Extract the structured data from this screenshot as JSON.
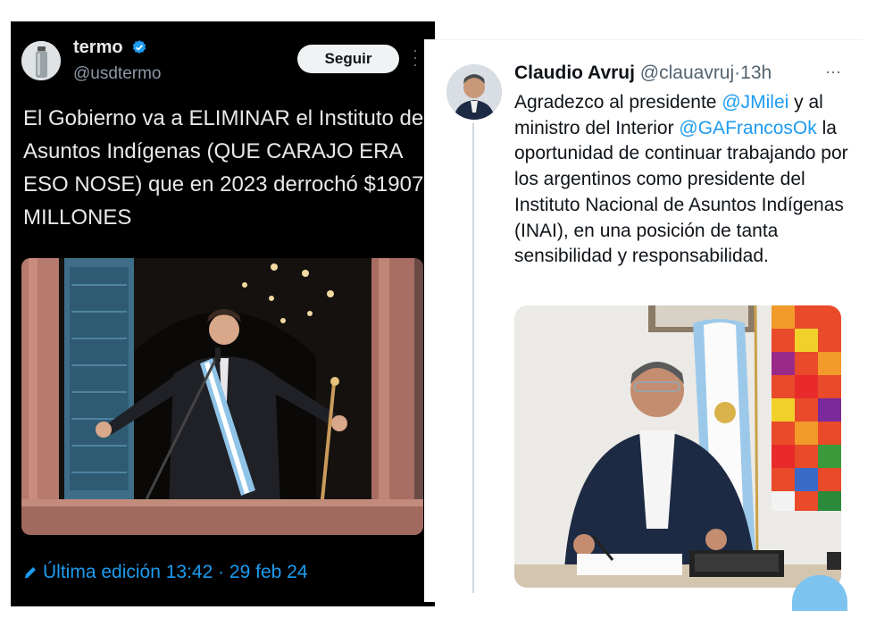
{
  "left_tweet": {
    "name": "termo",
    "handle": "@usdtermo",
    "follow_label": "Seguir",
    "text": "El Gobierno va a ELIMINAR el Instituto de Asuntos Indígenas (QUE CARAJO ERA ESO NOSE) que en 2023 derrochó $1907 MILLONES",
    "edited_label": "Última edición 13:42 · 29 feb 24",
    "icons": [
      "verified-badge-icon",
      "more-icon",
      "pencil-icon"
    ],
    "colors": {
      "background": "#000000",
      "accent": "#1d9bf0",
      "text": "#e7e9ea"
    }
  },
  "right_tweet": {
    "name": "Claudio Avruj",
    "handle": "@clauavruj",
    "separator": "·",
    "time": "13h",
    "text_parts": [
      {
        "type": "text",
        "value": "Agradezco al presidente "
      },
      {
        "type": "mention",
        "value": "@JMilei"
      },
      {
        "type": "text",
        "value": " y al ministro del Interior "
      },
      {
        "type": "mention",
        "value": "@GAFrancosOk"
      },
      {
        "type": "text",
        "value": " la oportunidad de continuar trabajando por los argentinos como presidente del Instituto Nacional de Asuntos Indígenas (INAI), en una posición de tanta sensibilidad y responsabilidad."
      }
    ],
    "icons": [
      "more-icon"
    ],
    "colors": {
      "background": "#ffffff",
      "mention": "#1d9bf0",
      "text": "#0f1419"
    }
  }
}
